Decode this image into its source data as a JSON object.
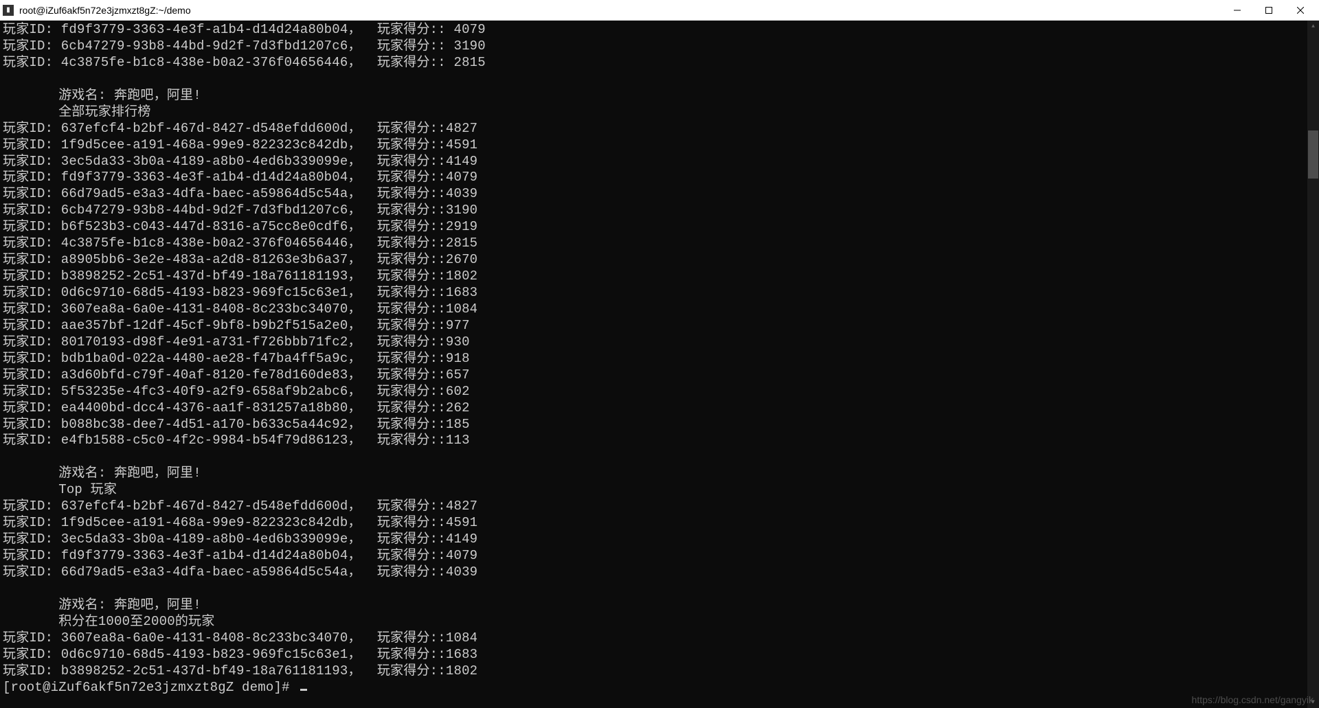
{
  "titlebar": {
    "icon_text": "C:\\",
    "title": "root@iZuf6akf5n72e3jzmxzt8gZ:~/demo"
  },
  "labels": {
    "player_id": "玩家ID:",
    "player_score": "玩家得分:",
    "game_name_label": "游戏名:",
    "game_name": "奔跑吧，阿里!",
    "section_all": "全部玩家排行榜",
    "section_top": "Top 玩家",
    "section_range": "积分在1000至2000的玩家"
  },
  "top_fragment": [
    {
      "id": "fd9f3779-3363-4e3f-a1b4-d14d24a80b04",
      "score": "4079",
      "spaced": true
    },
    {
      "id": "6cb47279-93b8-44bd-9d2f-7d3fbd1207c6",
      "score": "3190",
      "spaced": true
    },
    {
      "id": "4c3875fe-b1c8-438e-b0a2-376f04656446",
      "score": "2815",
      "spaced": true
    }
  ],
  "all_players": [
    {
      "id": "637efcf4-b2bf-467d-8427-d548efdd600d",
      "score": "4827"
    },
    {
      "id": "1f9d5cee-a191-468a-99e9-822323c842db",
      "score": "4591"
    },
    {
      "id": "3ec5da33-3b0a-4189-a8b0-4ed6b339099e",
      "score": "4149"
    },
    {
      "id": "fd9f3779-3363-4e3f-a1b4-d14d24a80b04",
      "score": "4079"
    },
    {
      "id": "66d79ad5-e3a3-4dfa-baec-a59864d5c54a",
      "score": "4039"
    },
    {
      "id": "6cb47279-93b8-44bd-9d2f-7d3fbd1207c6",
      "score": "3190"
    },
    {
      "id": "b6f523b3-c043-447d-8316-a75cc8e0cdf6",
      "score": "2919"
    },
    {
      "id": "4c3875fe-b1c8-438e-b0a2-376f04656446",
      "score": "2815"
    },
    {
      "id": "a8905bb6-3e2e-483a-a2d8-81263e3b6a37",
      "score": "2670"
    },
    {
      "id": "b3898252-2c51-437d-bf49-18a761181193",
      "score": "1802"
    },
    {
      "id": "0d6c9710-68d5-4193-b823-969fc15c63e1",
      "score": "1683"
    },
    {
      "id": "3607ea8a-6a0e-4131-8408-8c233bc34070",
      "score": "1084"
    },
    {
      "id": "aae357bf-12df-45cf-9bf8-b9b2f515a2e0",
      "score": "977"
    },
    {
      "id": "80170193-d98f-4e91-a731-f726bbb71fc2",
      "score": "930"
    },
    {
      "id": "bdb1ba0d-022a-4480-ae28-f47ba4ff5a9c",
      "score": "918"
    },
    {
      "id": "a3d60bfd-c79f-40af-8120-fe78d160de83",
      "score": "657"
    },
    {
      "id": "5f53235e-4fc3-40f9-a2f9-658af9b2abc6",
      "score": "602"
    },
    {
      "id": "ea4400bd-dcc4-4376-aa1f-831257a18b80",
      "score": "262"
    },
    {
      "id": "b088bc38-dee7-4d51-a170-b633c5a44c92",
      "score": "185"
    },
    {
      "id": "e4fb1588-c5c0-4f2c-9984-b54f79d86123",
      "score": "113"
    }
  ],
  "top_players": [
    {
      "id": "637efcf4-b2bf-467d-8427-d548efdd600d",
      "score": "4827"
    },
    {
      "id": "1f9d5cee-a191-468a-99e9-822323c842db",
      "score": "4591"
    },
    {
      "id": "3ec5da33-3b0a-4189-a8b0-4ed6b339099e",
      "score": "4149"
    },
    {
      "id": "fd9f3779-3363-4e3f-a1b4-d14d24a80b04",
      "score": "4079"
    },
    {
      "id": "66d79ad5-e3a3-4dfa-baec-a59864d5c54a",
      "score": "4039"
    }
  ],
  "range_players": [
    {
      "id": "3607ea8a-6a0e-4131-8408-8c233bc34070",
      "score": "1084"
    },
    {
      "id": "0d6c9710-68d5-4193-b823-969fc15c63e1",
      "score": "1683"
    },
    {
      "id": "b3898252-2c51-437d-bf49-18a761181193",
      "score": "1802"
    }
  ],
  "prompt": "[root@iZuf6akf5n72e3jzmxzt8gZ demo]#",
  "watermark": "https://blog.csdn.net/gangyik"
}
